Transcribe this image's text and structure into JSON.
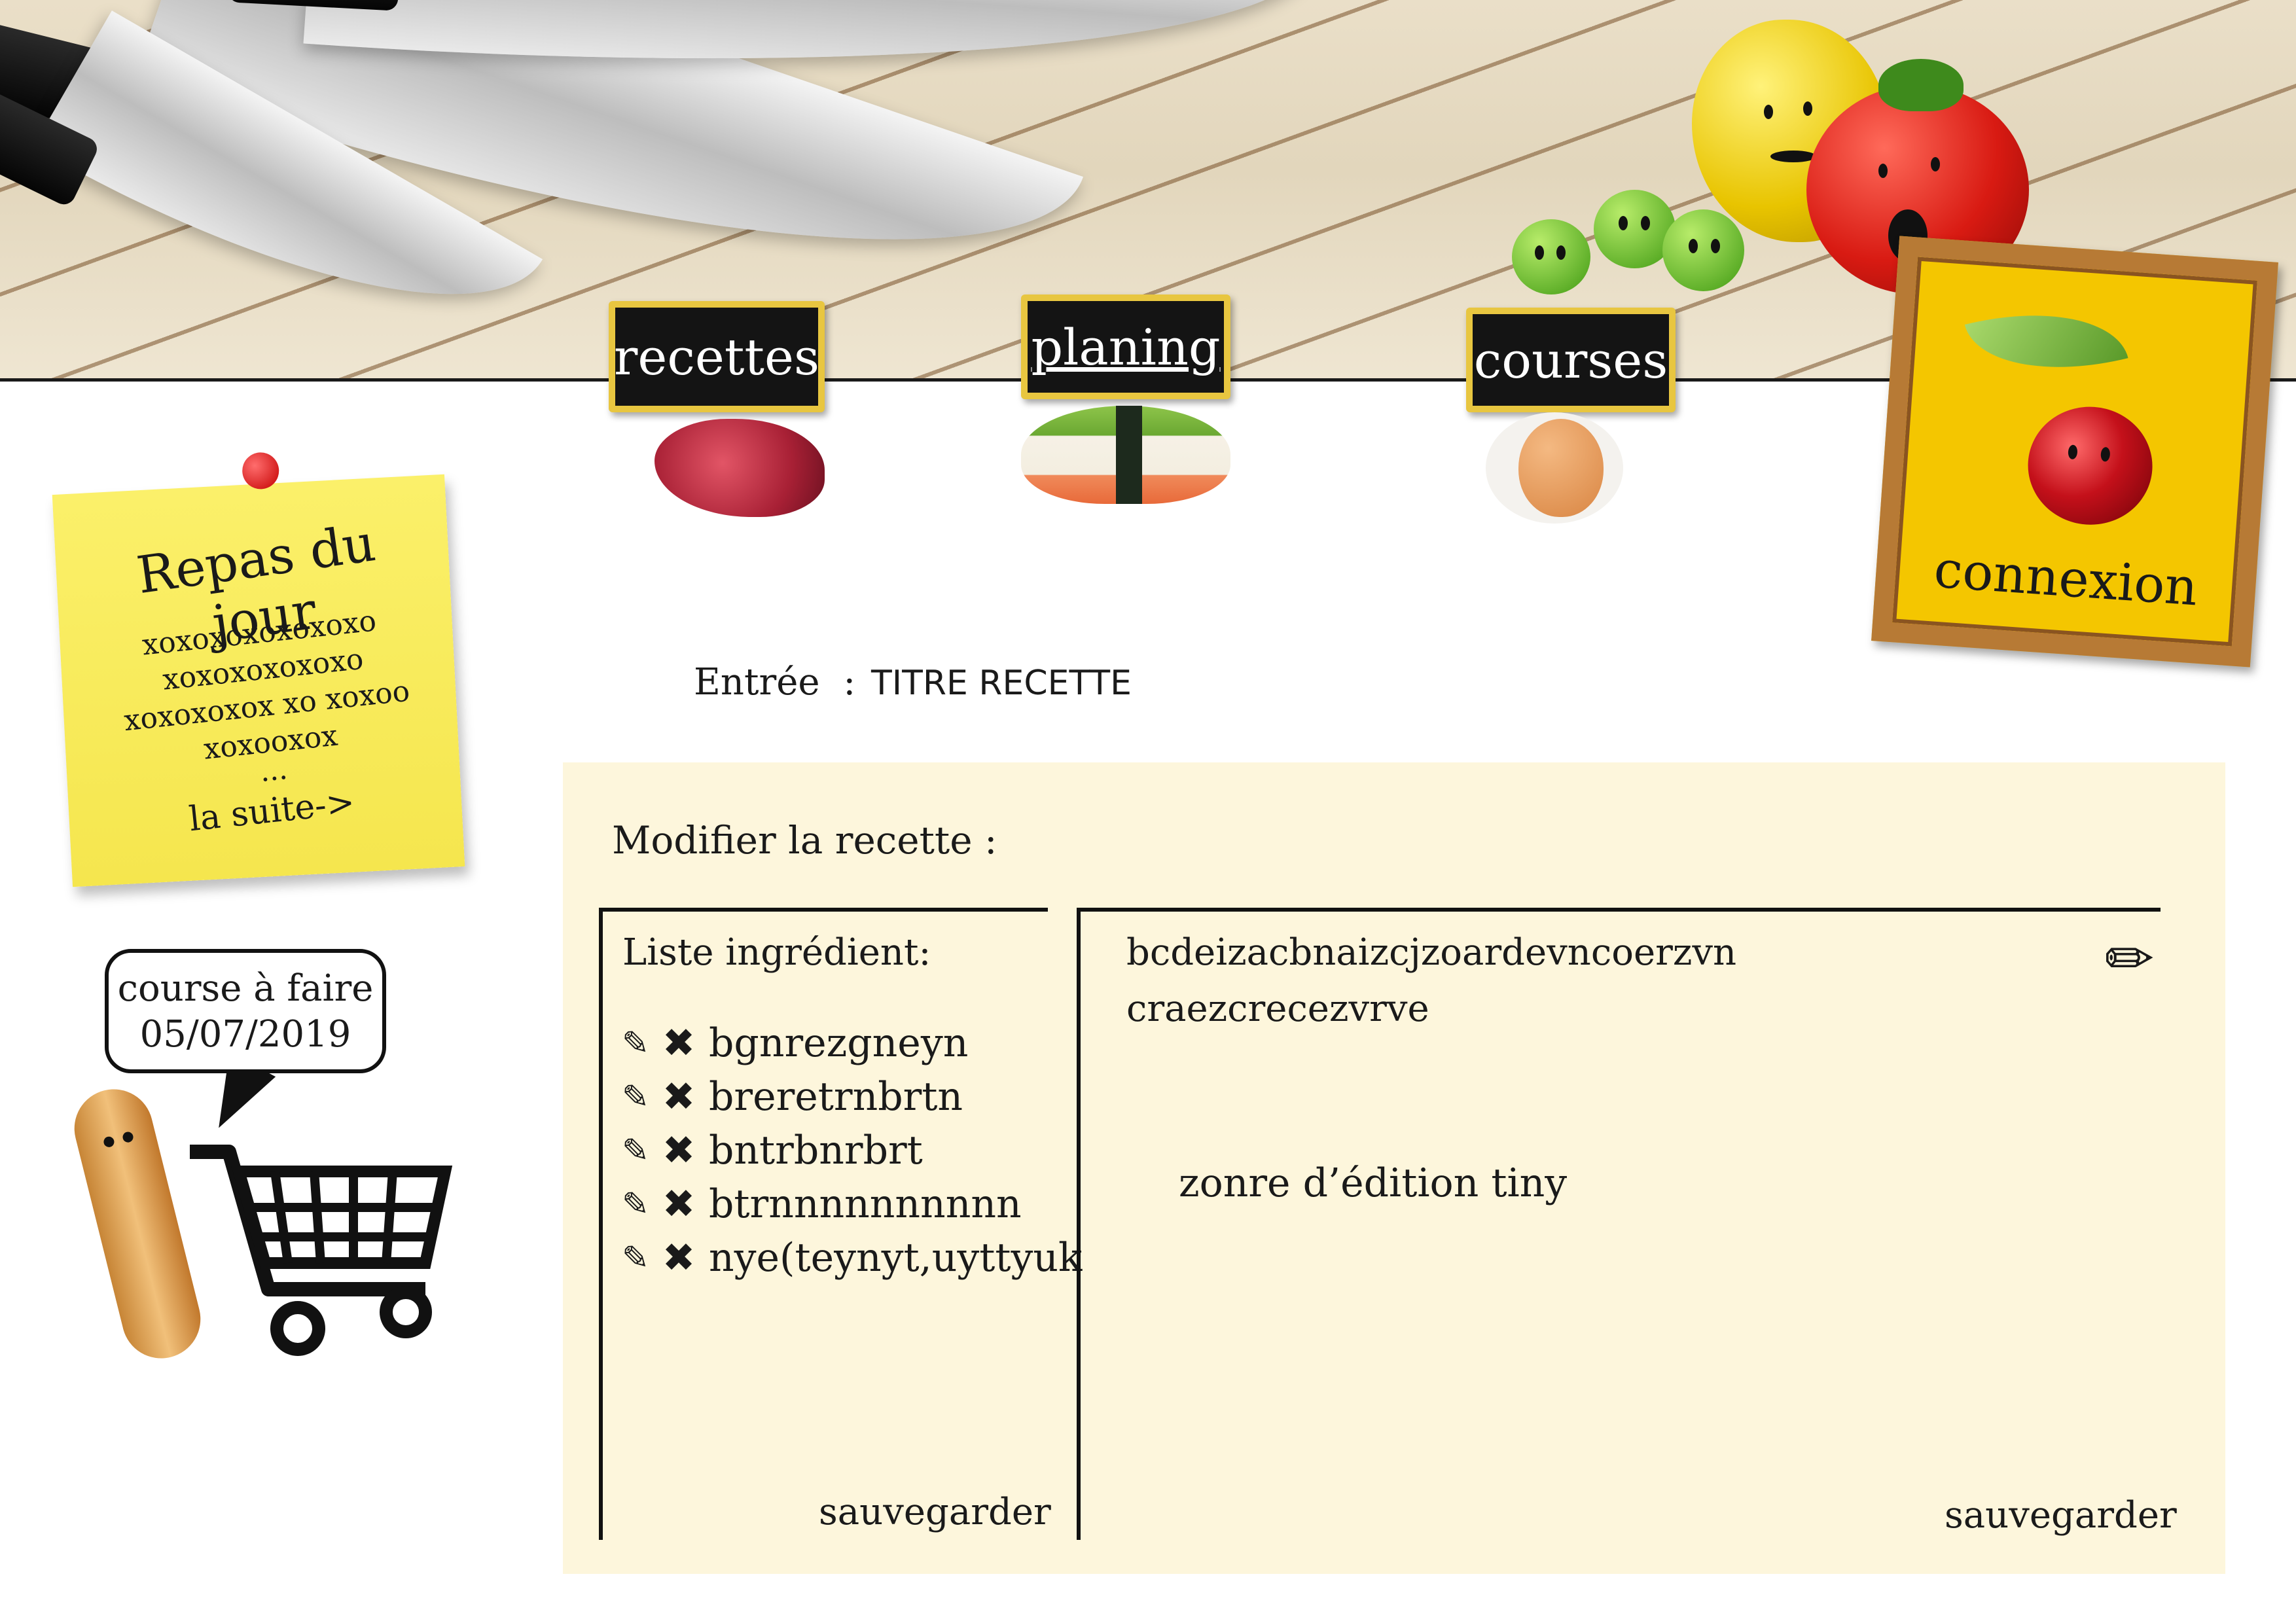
{
  "nav": {
    "recettes": "recettes",
    "planing": "planing",
    "courses": "courses",
    "connexion": "connexion"
  },
  "repas_du_jour": {
    "title": "Repas du jour",
    "lines": [
      "xoxoxoxoxoxoxo",
      "xoxoxoxoxoxo",
      "xoxoxoxox xo xoxoo",
      "xoxooxox",
      "..."
    ],
    "link": "la suite->"
  },
  "course_bubble": {
    "line1": "course à faire",
    "line2": "05/07/2019"
  },
  "recipe": {
    "category": "Entrée",
    "separator": ":",
    "title": "TITRE RECETTE"
  },
  "editor": {
    "panel_title": "Modifier la recette :",
    "ingredients_title": "Liste ingrédient:",
    "ingredients": [
      "bgnrezgneyn",
      "breretrnbrtn",
      "bntrbnrbrt",
      "btrnnnnnnnnnn",
      "nye(teynyt,uyttyuk"
    ],
    "edit_icon": "pencil-icon",
    "delete_icon": "cross-icon",
    "ingredients_save": "sauvegarder",
    "text_line1": "bcdeizacbnaizcjzoardevncoerzvn",
    "text_line2": "craezcrecezvrve",
    "text_hint": "zonre d’édition tiny",
    "text_save": "sauvegarder"
  }
}
